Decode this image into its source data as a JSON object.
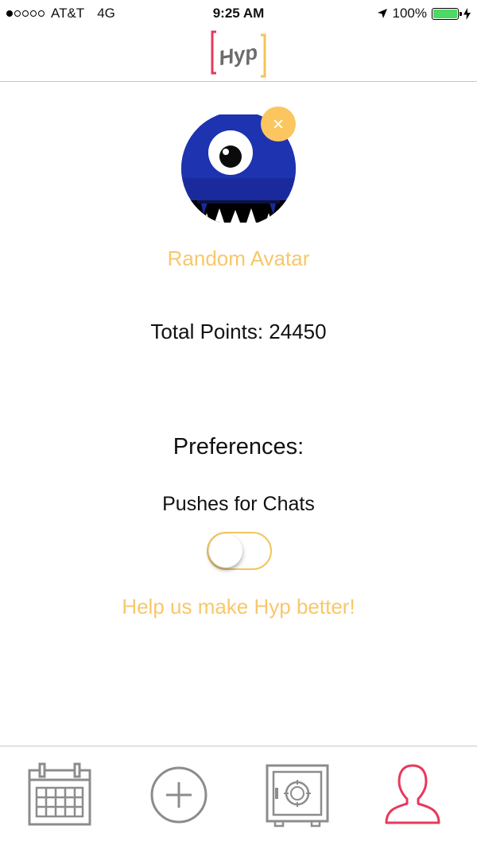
{
  "status_bar": {
    "carrier": "AT&T",
    "network": "4G",
    "time": "9:25 AM",
    "battery": "100%",
    "signal_bars_filled": 1,
    "signal_bars_total": 5
  },
  "header": {
    "logo_text": "Hyp"
  },
  "profile": {
    "random_avatar_label": "Random Avatar",
    "total_points": "Total Points: 24450"
  },
  "preferences": {
    "title": "Preferences:",
    "pushes_label": "Pushes for Chats",
    "pushes_enabled": false
  },
  "help_link": "Help us make Hyp better!",
  "tabbar": {
    "tabs": [
      {
        "icon": "calendar-icon"
      },
      {
        "icon": "plus-circle-icon"
      },
      {
        "icon": "safe-icon"
      },
      {
        "icon": "user-icon",
        "active": true
      }
    ]
  },
  "colors": {
    "accent": "#f8c76a",
    "active_tab": "#e8395c",
    "inactive_tab": "#8c8c8c",
    "avatar_blue": "#1a2a9c"
  }
}
